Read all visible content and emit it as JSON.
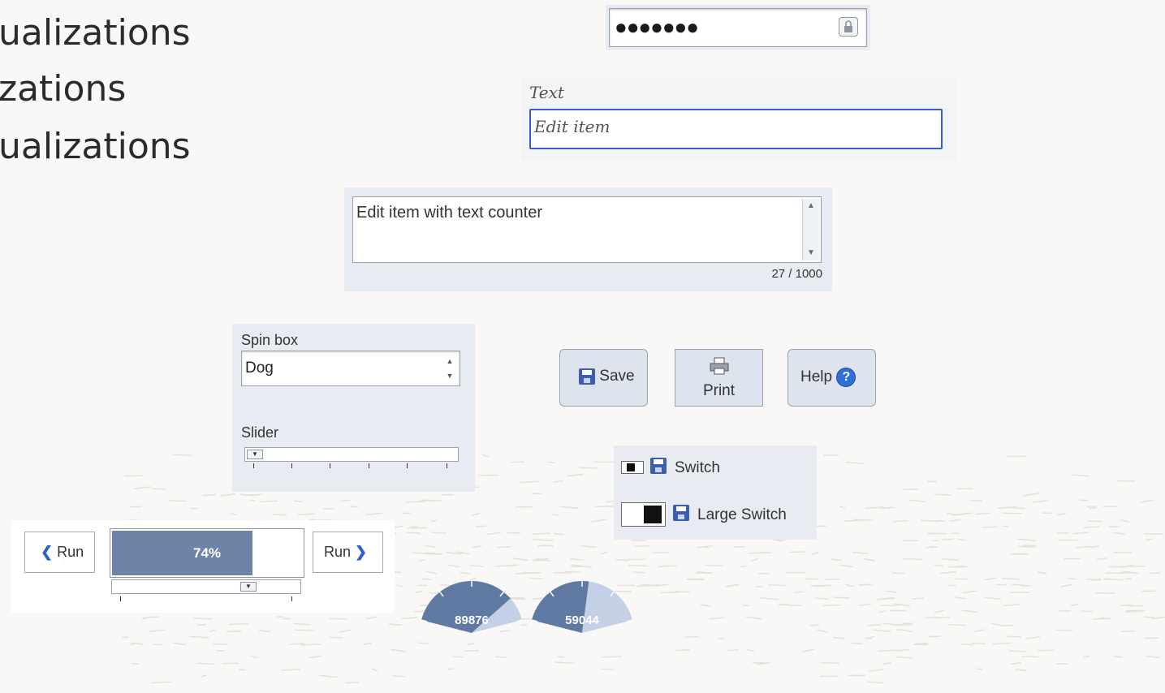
{
  "headings": [
    "ualizations",
    "zations",
    "ualizations"
  ],
  "password": {
    "dots": "●●●●●●●",
    "icon": "lock-icon"
  },
  "text_edit": {
    "label": "Text",
    "value": "Edit item"
  },
  "textarea": {
    "value": "Edit item with text counter",
    "counter": "27 / 1000"
  },
  "spin_box": {
    "label": "Spin box",
    "value": "Dog"
  },
  "slider": {
    "label": "Slider"
  },
  "buttons": {
    "save": {
      "label": "Save",
      "icon": "save-icon"
    },
    "print": {
      "label": "Print",
      "icon": "print-icon"
    },
    "help": {
      "label": "Help",
      "icon_glyph": "?"
    }
  },
  "switches": {
    "switch_label": "Switch",
    "large_switch_label": "Large Switch",
    "small_on": false,
    "large_on": true
  },
  "progress": {
    "run_left_label": "Run",
    "run_right_label": "Run",
    "text": "74%",
    "value": 0.74
  },
  "gauges": [
    {
      "value_text": "89876",
      "fill_fraction": 0.82
    },
    {
      "value_text": "59044",
      "fill_fraction": 0.55
    }
  ],
  "colors": {
    "accent": "#3b5bd6",
    "fill": "#6d84a8",
    "panel": "#e8ecf2"
  }
}
